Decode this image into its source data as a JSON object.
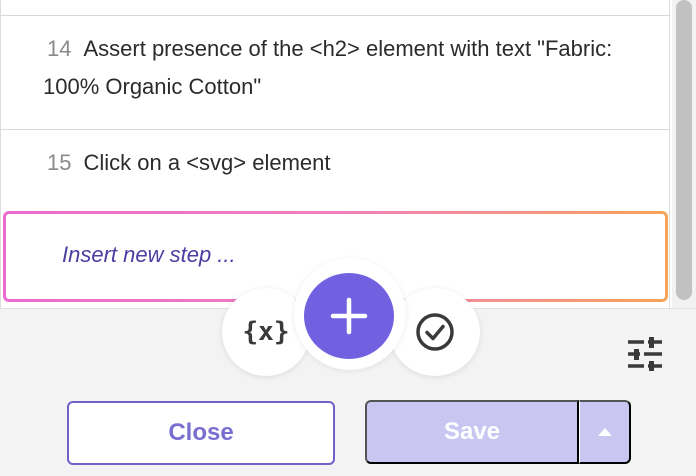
{
  "steps": [
    {
      "number": "14",
      "text": "Assert presence of the <h2> element with text \"Fabric: 100% Organic Cotton\""
    },
    {
      "number": "15",
      "text": "Click on a <svg> element"
    }
  ],
  "insert_step": {
    "placeholder": "Insert new step ..."
  },
  "toolbar": {
    "variable_label": "{x}",
    "add_icon": "plus-icon",
    "assert_icon": "check-circle-icon",
    "settings_icon": "sliders-icon"
  },
  "actions": {
    "close_label": "Close",
    "save_label": "Save",
    "save_dropdown_icon": "caret-up-icon"
  },
  "colors": {
    "accent": "#7161e0",
    "close_border": "#6e62c7",
    "save_disabled": "#c9c6f1",
    "insert_gradient_start": "#ec6ad1",
    "insert_gradient_end": "#f6a45a"
  }
}
